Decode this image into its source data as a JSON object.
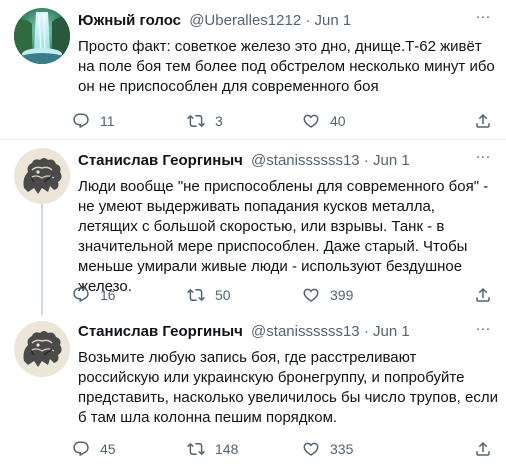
{
  "tweets": [
    {
      "display_name": "Южный голос",
      "handle": "@Uberalles1212",
      "date": "Jun 1",
      "text": "Просто факт: советкое железо это дно, днище.Т-62 живёт на поле боя тем более под обстрелом несколько минут ибо он не приспособлен для современного боя",
      "replies": "11",
      "retweets": "3",
      "likes": "40",
      "avatar_icon": "waterfall-avatar-icon"
    },
    {
      "display_name": "Станислав Георгиныч",
      "handle": "@stanissssss13",
      "date": "Jun 1",
      "text": "Люди вообще \"не приспособлены для современного боя\" - не умеют выдерживать попадания кусков металла, летящих с большой скоростью, или взрывы. Танк - в значительной мере приспособлен. Даже старый. Чтобы меньше умирали живые люди - используют бездушное железо.",
      "replies": "16",
      "retweets": "50",
      "likes": "399",
      "avatar_icon": "heraldic-beast-avatar-icon"
    },
    {
      "display_name": "Станислав Георгиныч",
      "handle": "@stanissssss13",
      "date": "Jun 1",
      "text": "Возьмите любую запись боя, где расстреливают российскую или украинскую бронегруппу, и попробуйте представить, насколько увеличилось бы число трупов, если б там шла колонна пешим порядком.",
      "replies": "45",
      "retweets": "148",
      "likes": "335",
      "avatar_icon": "heraldic-beast-avatar-icon"
    }
  ],
  "meta_separator": "·",
  "more_glyph": "···",
  "colors": {
    "text_primary": "#0f1419",
    "text_secondary": "#536471",
    "divider": "#eff3f4",
    "thread_line": "#cfd9de"
  }
}
